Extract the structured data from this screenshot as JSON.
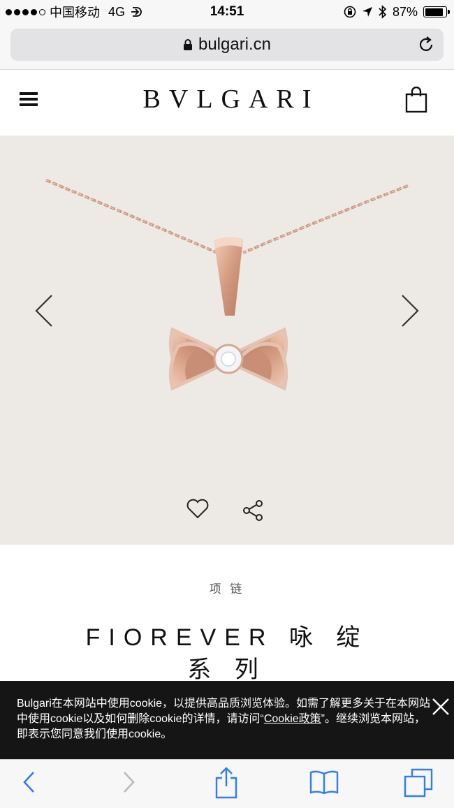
{
  "status_bar": {
    "carrier": "中国移动",
    "network": "4G",
    "time": "14:51",
    "battery": "87%",
    "battery_level": 0.87
  },
  "browser": {
    "url": "bulgari.cn"
  },
  "header": {
    "brand": "BVLGARI",
    "menu_icon": "hamburger-menu-icon",
    "bag_icon": "shopping-bag-icon"
  },
  "product": {
    "category": "项 链",
    "title_line1": "FIOREVER 咏 绽",
    "title_line2": "系 列"
  },
  "cookie_banner": {
    "text_before": "Bulgari在本网站中使用cookie，以提供高品质浏览体验。如需了解更多关于在本网站中使用cookie以及如何删除cookie的详情，请访问“",
    "link_text": "Cookie政策",
    "text_after": "”。继续浏览本网站，即表示您同意我们使用cookie。"
  },
  "colors": {
    "hero_bg": "#edeae6",
    "banner_bg": "#151515",
    "ios_blue": "#2f7cf6",
    "gold": "#d8a48a"
  }
}
